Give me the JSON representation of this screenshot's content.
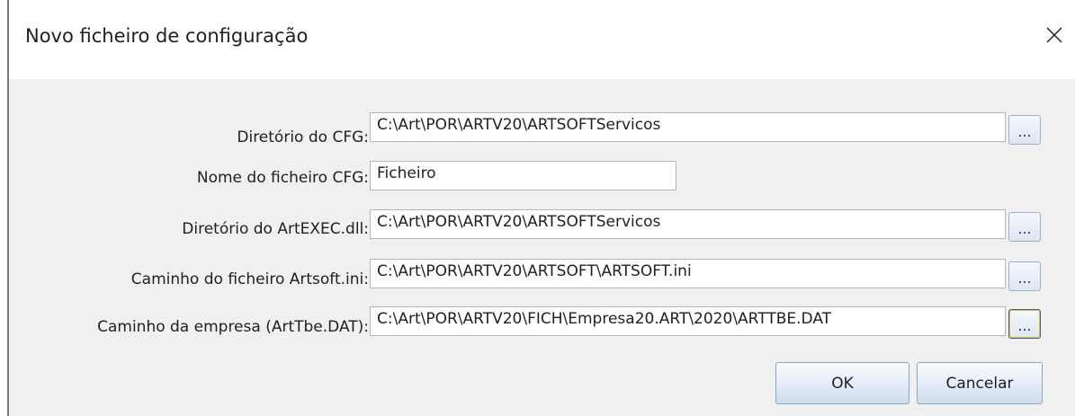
{
  "dialog": {
    "title": "Novo ficheiro de configuração",
    "close_icon": "close-icon"
  },
  "form": {
    "rows": [
      {
        "label": "Diretório do CFG:",
        "value": "C:\\Art\\POR\\ARTV20\\ARTSOFTServicos",
        "browse_label": "..."
      },
      {
        "label": "Nome do ficheiro CFG:",
        "value": "Ficheiro"
      },
      {
        "label": "Diretório do ArtEXEC.dll:",
        "value": "C:\\Art\\POR\\ARTV20\\ARTSOFTServicos",
        "browse_label": "..."
      },
      {
        "label": "Caminho do ficheiro Artsoft.ini:",
        "value": "C:\\Art\\POR\\ARTV20\\ARTSOFT\\ARTSOFT.ini",
        "browse_label": "..."
      },
      {
        "label": "Caminho da empresa (ArtTbe.DAT):",
        "value": "C:\\Art\\POR\\ARTV20\\FICH\\Empresa20.ART\\2020\\ARTTBE.DAT",
        "browse_label": "..."
      }
    ]
  },
  "buttons": {
    "ok_label": "OK",
    "cancel_label": "Cancelar"
  },
  "colors": {
    "client_bg": "#f0f0f0",
    "button_border": "#8ea6c6"
  }
}
